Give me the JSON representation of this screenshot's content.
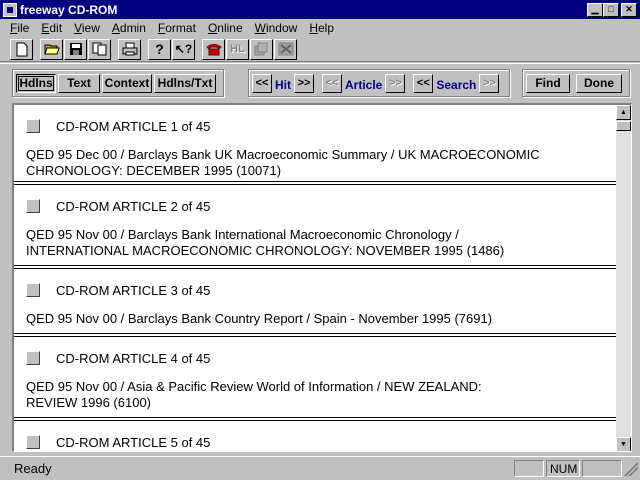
{
  "window": {
    "title": "freeway CD-ROM",
    "controls": [
      "minimize",
      "maximize",
      "close"
    ]
  },
  "menubar": {
    "items": [
      {
        "label": "File",
        "mnemonic": "F",
        "rest": "ile"
      },
      {
        "label": "Edit",
        "mnemonic": "E",
        "rest": "dit"
      },
      {
        "label": "View",
        "mnemonic": "V",
        "rest": "iew"
      },
      {
        "label": "Admin",
        "mnemonic": "A",
        "rest": "dmin"
      },
      {
        "label": "Format",
        "mnemonic": "F",
        "rest": "ormat"
      },
      {
        "label": "Online",
        "mnemonic": "O",
        "rest": "nline"
      },
      {
        "label": "Window",
        "mnemonic": "W",
        "rest": "indow"
      },
      {
        "label": "Help",
        "mnemonic": "H",
        "rest": "elp"
      }
    ]
  },
  "toolbar": {
    "buttons": [
      {
        "icon": "new-document-icon",
        "enabled": true
      },
      {
        "icon": "open-folder-icon",
        "enabled": true
      },
      {
        "icon": "save-disk-icon",
        "enabled": true
      },
      {
        "icon": "copy-icon",
        "enabled": true
      },
      {
        "icon": "print-icon",
        "enabled": true
      },
      {
        "icon": "help-icon",
        "enabled": true
      },
      {
        "icon": "context-help-icon",
        "enabled": true
      },
      {
        "icon": "phone-icon",
        "enabled": true
      },
      {
        "icon": "hl-icon",
        "label": "HL",
        "enabled": false
      },
      {
        "icon": "stack-icon",
        "enabled": false
      },
      {
        "icon": "cross-icon",
        "enabled": false
      }
    ]
  },
  "navbar": {
    "views": [
      {
        "label": "Hdlns",
        "pressed": true
      },
      {
        "label": "Text",
        "pressed": false
      },
      {
        "label": "Context",
        "pressed": false
      },
      {
        "label": "Hdlns/Txt",
        "pressed": false
      }
    ],
    "hit": {
      "prev": "<<",
      "label": "Hit",
      "next": ">>"
    },
    "article": {
      "prev": "<<",
      "label": "Article",
      "next": ">>"
    },
    "search": {
      "prev": "<<",
      "label": "Search",
      "next": ">>"
    },
    "find_label": "Find",
    "done_label": "Done"
  },
  "articles": [
    {
      "header": "CD-ROM ARTICLE 1 of 45",
      "lines": [
        "QED 95 Dec 00 / Barclays Bank UK Macroeconomic Summary  / UK MACROECONOMIC",
        "CHRONOLOGY: DECEMBER 1995 (10071)"
      ]
    },
    {
      "header": "CD-ROM ARTICLE 2 of 45",
      "lines": [
        "QED 95 Nov 00 / Barclays Bank International Macroeconomic Chronology  /",
        "INTERNATIONAL MACROECONOMIC CHRONOLOGY:  NOVEMBER 1995 (1486)"
      ]
    },
    {
      "header": "CD-ROM ARTICLE 3 of 45",
      "lines": [
        "QED 95 Nov 00 / Barclays Bank Country Report  / Spain - November 1995 (7691)"
      ]
    },
    {
      "header": "CD-ROM ARTICLE 4 of 45",
      "lines": [
        "QED 95 Nov 00 / Asia & Pacific Review World of Information  / NEW ZEALAND:",
        "REVIEW 1996 (6100)"
      ]
    },
    {
      "header": "CD-ROM ARTICLE 5 of 45",
      "lines": []
    }
  ],
  "statusbar": {
    "text": "Ready",
    "panels": [
      "",
      "NUM",
      ""
    ]
  }
}
